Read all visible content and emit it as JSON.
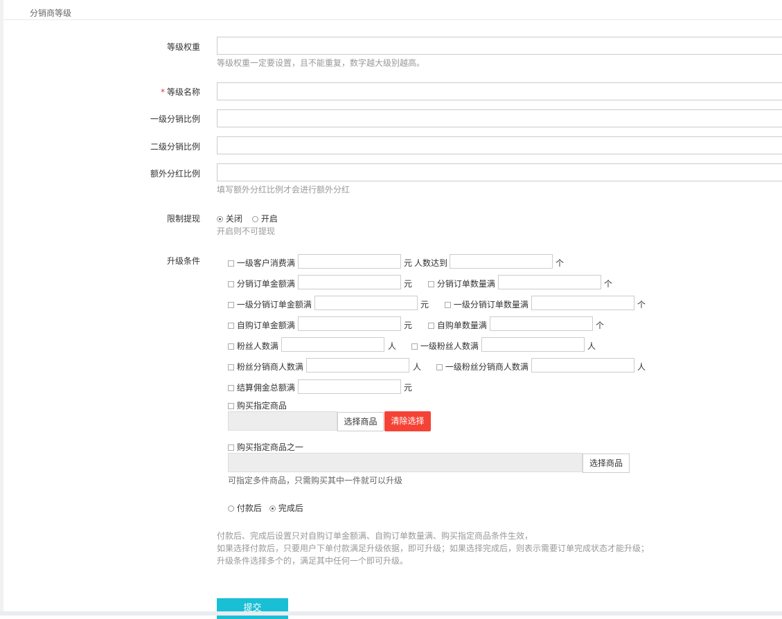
{
  "header": {
    "title": "分销商等级"
  },
  "form": {
    "weight": {
      "label": "等级权重",
      "help": "等级权重一定要设置，且不能重复，数字越大级别越高。"
    },
    "name": {
      "required_mark": "*",
      "label": "等级名称"
    },
    "level1": {
      "label": "一级分销比例"
    },
    "level2": {
      "label": "二级分销比例"
    },
    "extra": {
      "label": "额外分红比例",
      "help": "填写额外分红比例才会进行额外分红"
    },
    "limit": {
      "label": "限制提现",
      "options": [
        "关闭",
        "开启"
      ],
      "selected": "关闭",
      "help": "开启则不可提现"
    },
    "upgrade": {
      "label": "升级条件",
      "conds": {
        "c1": "一级客户消费满",
        "u1": "元",
        "c1b": "人数达到",
        "u1b": "个",
        "c2": "分销订单金额满",
        "u2": "元",
        "c2b": "分销订单数量满",
        "u2b": "个",
        "c3": "一级分销订单金额满",
        "u3": "元",
        "c3b": "一级分销订单数量满",
        "u3b": "个",
        "c4": "自购订单金额满",
        "u4": "元",
        "c4b": "自购单数量满",
        "u4b": "个",
        "c5": "粉丝人数满",
        "u5": "人",
        "c5b": "一级粉丝人数满",
        "u5b": "人",
        "c6": "粉丝分销商人数满",
        "u6": "人",
        "c6b": "一级粉丝分销商人数满",
        "u6b": "人",
        "c7": "结算佣金总额满",
        "u7": "元",
        "c8": "购买指定商品",
        "c9": "购买指定商品之一"
      },
      "select_goods": "选择商品",
      "clear_select": "清除选择",
      "select_goods2": "选择商品",
      "help_goods": "可指定多件商品，只需购买其中一件就可以升级",
      "timing_options": [
        "付款后",
        "完成后"
      ],
      "timing_selected": "完成后",
      "note1": "付款后、完成后设置只对自购订单金额满、自购订单数量满、购买指定商品条件生效，",
      "note2": "如果选择付款后，只要用户下单付款满足升级依据，即可升级；如果选择完成后，则表示需要订单完成状态才能升级；",
      "note3": "升级条件选择多个的，满足其中任何一个即可升级。"
    },
    "submit": "提交"
  }
}
